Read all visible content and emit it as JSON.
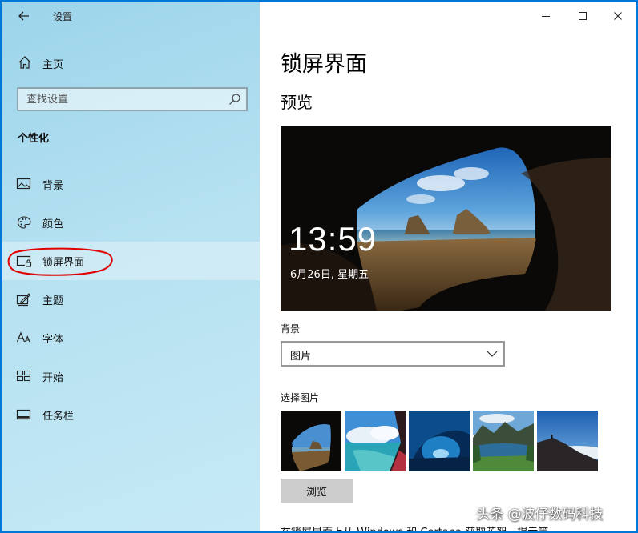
{
  "window": {
    "title": "设置",
    "controls": {
      "minimize": "minimize-icon",
      "maximize": "maximize-icon",
      "close": "close-icon"
    }
  },
  "sidebar": {
    "home_label": "主页",
    "search_placeholder": "查找设置",
    "section_title": "个性化",
    "items": [
      {
        "label": "背景",
        "icon": "image-icon"
      },
      {
        "label": "颜色",
        "icon": "palette-icon"
      },
      {
        "label": "锁屏界面",
        "icon": "lock-screen-icon",
        "active": true
      },
      {
        "label": "主题",
        "icon": "theme-icon"
      },
      {
        "label": "字体",
        "icon": "font-icon"
      },
      {
        "label": "开始",
        "icon": "start-icon"
      },
      {
        "label": "任务栏",
        "icon": "taskbar-icon"
      }
    ]
  },
  "main": {
    "title": "锁屏界面",
    "preview_title": "预览",
    "preview": {
      "time": "13:59",
      "date": "6月26日, 星期五"
    },
    "background_label": "背景",
    "background_value": "图片",
    "choose_label": "选择图片",
    "browse_label": "浏览",
    "bottom_text": "在锁屏界面上从 Windows 和 Cortana 获取花絮、提示等"
  },
  "watermark": "头条 @波仔数码科技",
  "colors": {
    "accent": "#0078d7",
    "sidebar_bg": "#b5e1f1",
    "annotation": "#e00000"
  }
}
